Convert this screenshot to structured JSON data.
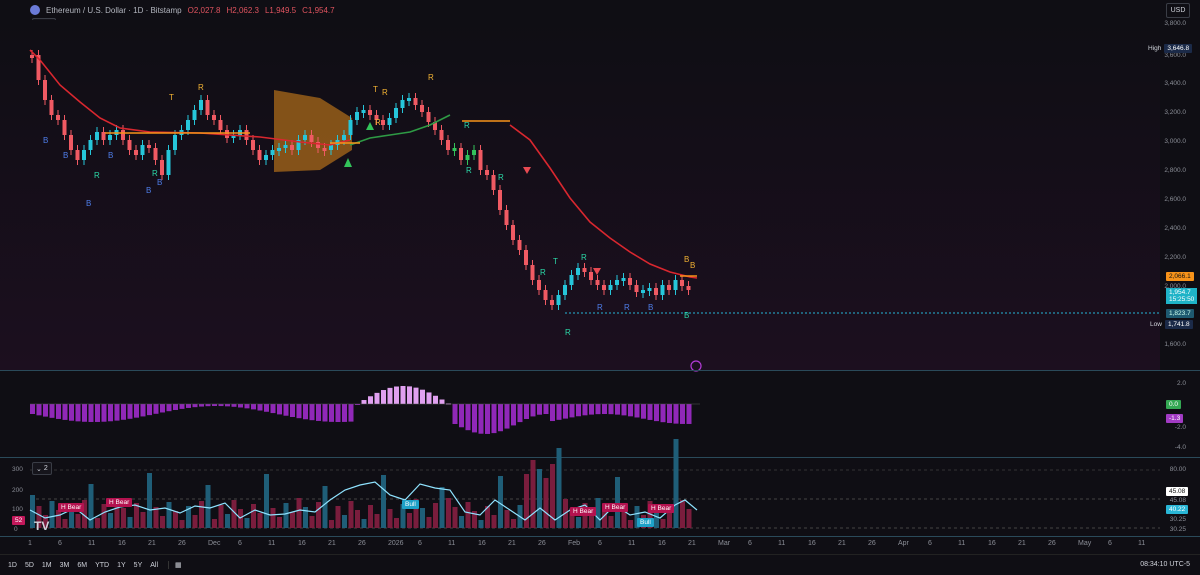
{
  "header": {
    "symbol_title": "Ethereum / U.S. Dollar · 1D · Bitstamp",
    "open": "O2,027.8",
    "high": "H2,062.3",
    "low": "L1,949.5",
    "close": "C1,954.7",
    "indicator_count": "12",
    "currency": "USD"
  },
  "price_axis": {
    "labels": [
      "3,800.0",
      "3,600.0",
      "3,400.0",
      "3,200.0",
      "3,000.0",
      "2,800.0",
      "2,600.0",
      "2,400.0",
      "2,200.0",
      "2,000.0",
      "1,600.0"
    ],
    "high_label": "High",
    "high_value": "3,646.8",
    "low_label": "Low",
    "low_value": "1,741.8",
    "orange_tag": "2,066.1",
    "price_tag": "1,954.7",
    "countdown": "15:25:50",
    "dotted_tag": "1,823.7"
  },
  "macd_axis": {
    "labels": [
      "2.0",
      "-2.0",
      "-4.0"
    ],
    "green_tag": "0.0",
    "purple_tag": "-1.3"
  },
  "volume_pane": {
    "indicator_count": "2",
    "left_labels": [
      "300",
      "200",
      "100",
      "0"
    ],
    "left_tag": "52",
    "right_labels": [
      "80.00",
      "45.08",
      "30.25",
      "30.25"
    ],
    "white_tag": "45.08",
    "cyan_tag": "40.22",
    "annotations": [
      "H Bear",
      "H Bear",
      "Bull",
      "H Bear",
      "H Bear",
      "Bull",
      "H Bear"
    ]
  },
  "chart_data": {
    "type": "candlestick",
    "series_name": "Ethereum / U.S. Dollar",
    "signals": [
      "B",
      "B",
      "B",
      "B",
      "B",
      "B",
      "R",
      "R",
      "T",
      "R",
      "T",
      "R",
      "R",
      "R",
      "R",
      "R",
      "R",
      "T",
      "R",
      "R",
      "R",
      "R",
      "R",
      "B",
      "B",
      "B",
      "B"
    ]
  },
  "time_axis": {
    "labels": [
      "1",
      "6",
      "11",
      "16",
      "21",
      "26",
      "Dec",
      "6",
      "11",
      "16",
      "21",
      "26",
      "2026",
      "6",
      "11",
      "16",
      "21",
      "26",
      "Feb",
      "6",
      "11",
      "16",
      "21",
      "Mar",
      "6",
      "11",
      "16",
      "21",
      "26",
      "Apr",
      "6",
      "11",
      "16",
      "21",
      "26",
      "May",
      "6",
      "11"
    ]
  },
  "bottom_bar": {
    "timeframes": [
      "1D",
      "5D",
      "1M",
      "3M",
      "6M",
      "YTD",
      "1Y",
      "5Y",
      "All"
    ],
    "clock": "08:34:10 UTC-5"
  }
}
